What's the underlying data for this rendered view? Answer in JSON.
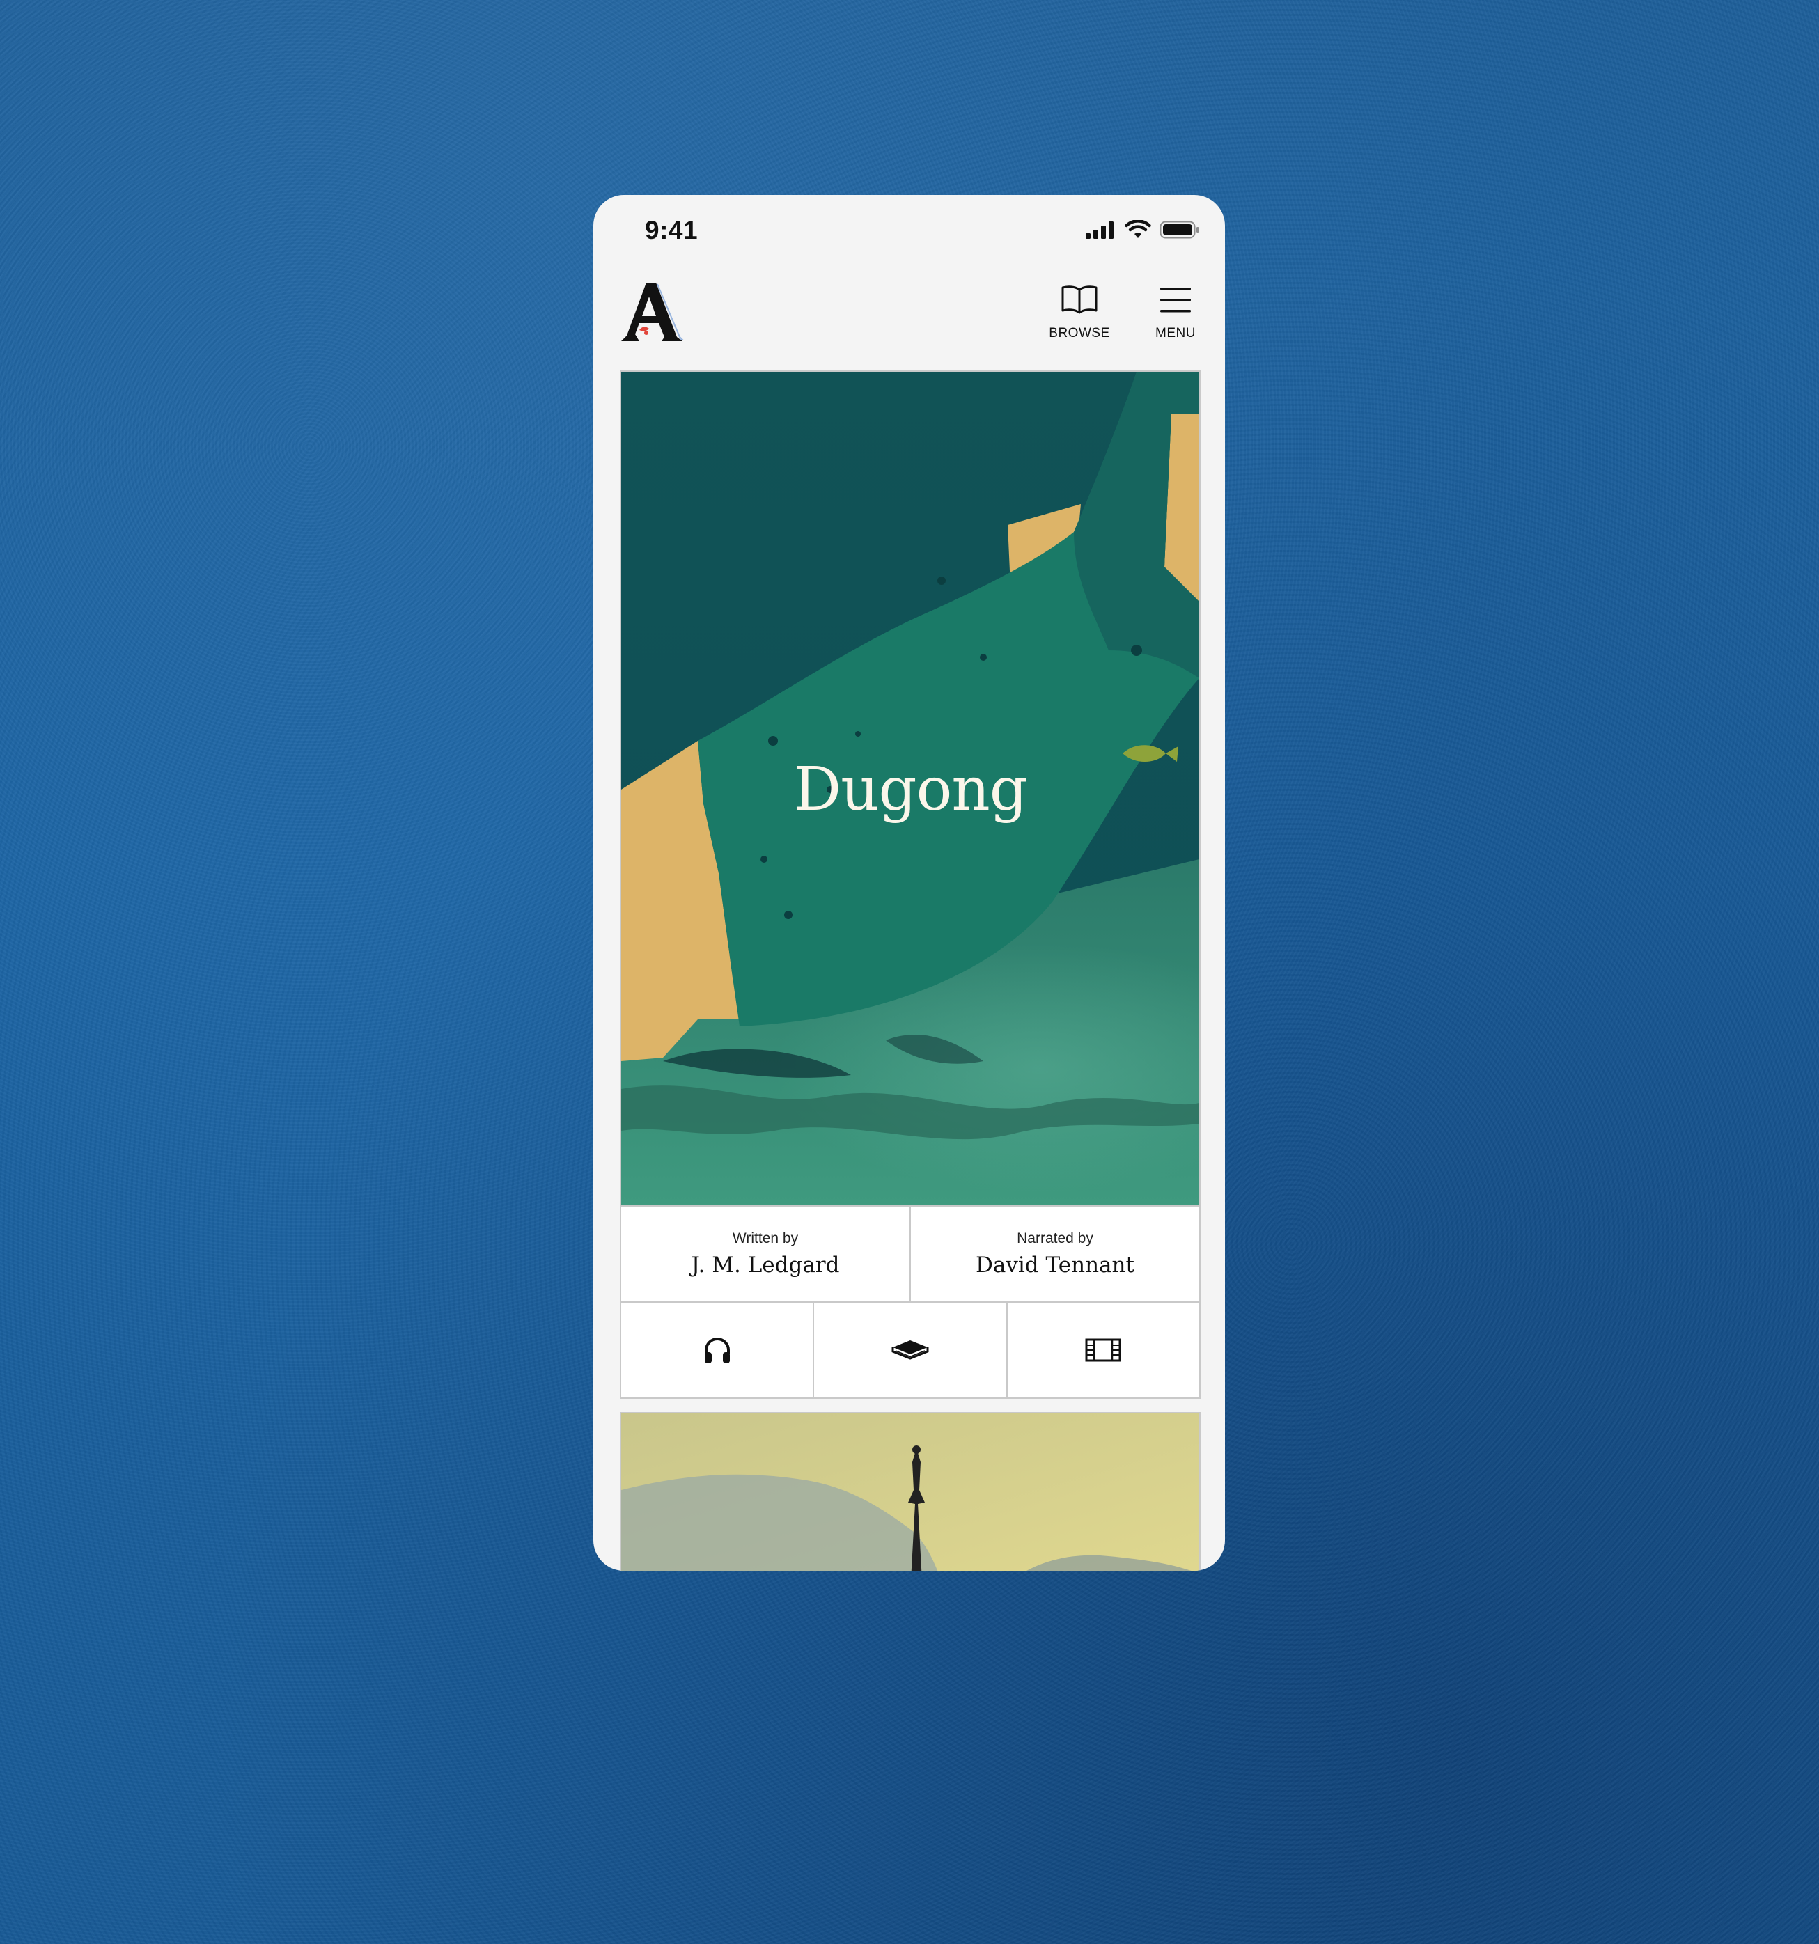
{
  "status_bar": {
    "time": "9:41",
    "icons": [
      "signal-icon",
      "wifi-icon",
      "battery-icon"
    ]
  },
  "header": {
    "logo_icon": "atlantic-a-logo",
    "browse_label": "BROWSE",
    "menu_label": "MENU"
  },
  "story": {
    "title": "Dugong",
    "written_by_label": "Written by",
    "author": "J. M. Ledgard",
    "narrated_by_label": "Narrated by",
    "narrator": "David Tennant",
    "formats": [
      "headphones-icon",
      "book-icon",
      "film-icon"
    ]
  },
  "colors": {
    "background": "#1b63a3",
    "phone": "#f4f4f4",
    "cover_dark": "#0f5356",
    "cover_green": "#1a7a67",
    "cover_sand": "#ddb468",
    "title_text": "#fbf6ea"
  }
}
